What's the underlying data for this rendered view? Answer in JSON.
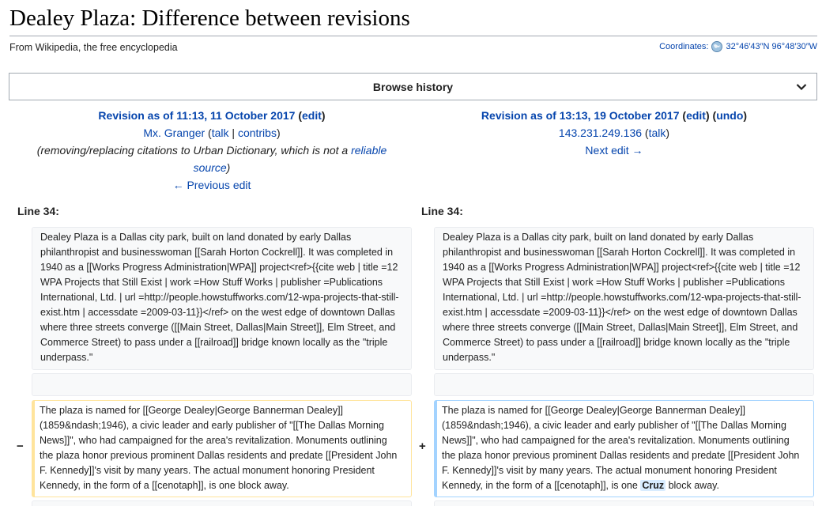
{
  "page": {
    "title": "Dealey Plaza: Difference between revisions",
    "tagline": "From Wikipedia, the free encyclopedia",
    "coordinates_label": "Coordinates:",
    "coordinates_value": "32°46′43″N 96°48′30″W"
  },
  "browse": {
    "label": "Browse history"
  },
  "left_rev": {
    "heading": "Revision as of 11:13, 11 October 2017",
    "edit": "edit",
    "user": "Mx. Granger",
    "talk": "talk",
    "sep": "|",
    "contribs": "contribs",
    "summary_start": "(removing/replacing citations to Urban Dictionary, which is not a",
    "summary_link_1": "reliable",
    "summary_link_2": "source",
    "summary_end": ")",
    "prev": "← Previous edit"
  },
  "right_rev": {
    "heading": "Revision as of 13:13, 19 October 2017",
    "edit": "edit",
    "undo": "undo",
    "ip": "143.231.249.136",
    "talk": "talk",
    "next": "Next edit →"
  },
  "diff": {
    "line_label_left": "Line 34:",
    "line_label_right": "Line 34:",
    "context_text": "Dealey Plaza is a Dallas city park, built on land donated by early Dallas philanthropist and businesswoman  [[Sarah Horton Cockrell]]. It was completed in 1940 as a [[Works Progress Administration|WPA]] project<ref>{{cite web | title =12 WPA Projects that Still Exist | work =How Stuff Works | publisher =Publications International, Ltd. | url =http://people.howstuffworks.com/12-wpa-projects-that-still-exist.htm | accessdate =2009-03-11}}</ref> on the west edge of downtown Dallas where three streets converge ([[Main Street, Dallas|Main Street]], Elm Street, and Commerce Street) to pass under a [[railroad]] bridge known locally as the \"triple underpass.\"",
    "minus": "−",
    "plus": "+",
    "deleted_text": "The plaza is named for [[George Dealey|George Bannerman Dealey]] (1859&ndash;1946), a civic leader and early publisher of \"[[The Dallas Morning News]]\", who had campaigned for the area's revitalization. Monuments outlining the plaza honor previous prominent Dallas residents and predate [[President John F. Kennedy]]'s visit by many years. The actual monument honoring President Kennedy, in the form of a [[cenotaph]], is one block away.",
    "added_text_start": "The plaza is named for [[George Dealey|George Bannerman Dealey]] (1859&ndash;1946), a civic leader and early publisher of \"[[The Dallas Morning News]]\", who had campaigned for the area's revitalization. Monuments outlining the plaza honor previous prominent Dallas residents and predate [[President John F. Kennedy]]'s visit by many years. The actual monument honoring President Kennedy, in the form of a [[cenotaph]], is one ",
    "added_highlight": "Cruz",
    "added_text_end": " block away."
  },
  "colors": {
    "link": "#0645ad",
    "deleted_border": "#ffe49c",
    "added_border": "#a3d3ff",
    "added_highlight": "#d8ecff",
    "context_bg": "#f8f9fa"
  }
}
